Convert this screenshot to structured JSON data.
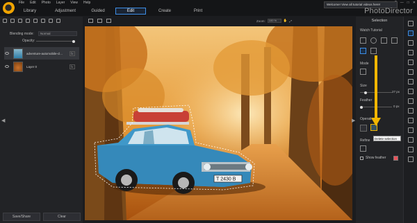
{
  "menu": {
    "items": [
      "File",
      "Edit",
      "Photo",
      "Layer",
      "View",
      "Help"
    ]
  },
  "notification": "Welcome! View all tutorial videos here!",
  "window_controls": [
    "?",
    "—",
    "□",
    "✕"
  ],
  "tabs": [
    {
      "label": "Library",
      "active": false
    },
    {
      "label": "Adjustment",
      "active": false
    },
    {
      "label": "Guided",
      "active": false
    },
    {
      "label": "Edit",
      "active": true
    },
    {
      "label": "Create",
      "active": false
    },
    {
      "label": "Print",
      "active": false
    }
  ],
  "brand": "PhotoDirector",
  "layers_panel": {
    "blending_label": "Blending mode:",
    "blending_value": "Normal",
    "opacity_label": "Opacity:",
    "layers": [
      {
        "name": "adventure-automobile-cl...",
        "fx": "fx",
        "selected": true
      },
      {
        "name": "Layer 0",
        "fx": "fx",
        "selected": false
      }
    ],
    "save_share": "Save/Share",
    "clear": "Clear"
  },
  "canvas_toolbar": {
    "zoom_label": "Zoom:",
    "zoom_value": "100 %"
  },
  "canvas": {
    "license_plate": "Т 2430 В"
  },
  "selection_panel": {
    "title": "Selection",
    "watch_tutorial": "Watch Tutorial",
    "mode_label": "Mode",
    "size_label": "Size",
    "size_value": "27 px",
    "feather_label": "Feather",
    "feather_value": "0 px",
    "operation_label": "Operation",
    "tooltip": "Delete selection",
    "refine_label": "Refine",
    "show_feather_label": "Show feather",
    "feather_color": "#e9535a"
  },
  "accent": {
    "highlight": "#f2b600",
    "active_tab": "#3d8fe8"
  }
}
